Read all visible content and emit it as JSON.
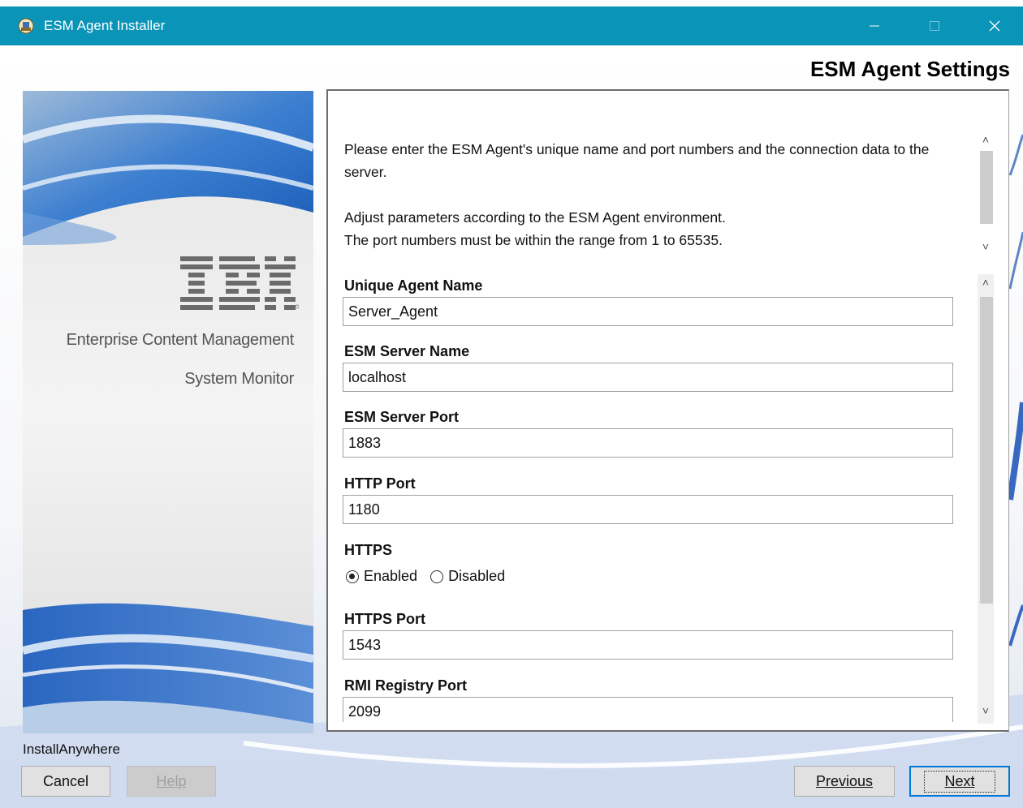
{
  "window": {
    "title": "ESM Agent Installer",
    "accent_color": "#0a94b8"
  },
  "header": {
    "title": "ESM Agent Settings"
  },
  "left_panel": {
    "logo": "IBM",
    "brand_line1": "Enterprise Content Management",
    "brand_line2": "System Monitor"
  },
  "intro": {
    "line1": "Please enter the ESM Agent's unique name and port numbers and the connection data to the server.",
    "line2": "Adjust parameters according to the ESM Agent environment.",
    "line3": "The port numbers must be within the range from 1 to 65535."
  },
  "fields": [
    {
      "label": "Unique Agent Name",
      "value": "Server_Agent"
    },
    {
      "label": "ESM Server Name",
      "value": "localhost"
    },
    {
      "label": "ESM Server Port",
      "value": "1883"
    },
    {
      "label": "HTTP Port",
      "value": "1180"
    },
    {
      "label": "HTTPS Port",
      "value": "1543"
    },
    {
      "label": "RMI Registry Port",
      "value": "2099"
    }
  ],
  "https": {
    "label": "HTTPS",
    "options": [
      "Enabled",
      "Disabled"
    ],
    "selected": "Enabled"
  },
  "footer": {
    "vendor": "InstallAnywhere",
    "cancel": "Cancel",
    "help": "Help",
    "previous": "Previous",
    "next": "Next"
  }
}
